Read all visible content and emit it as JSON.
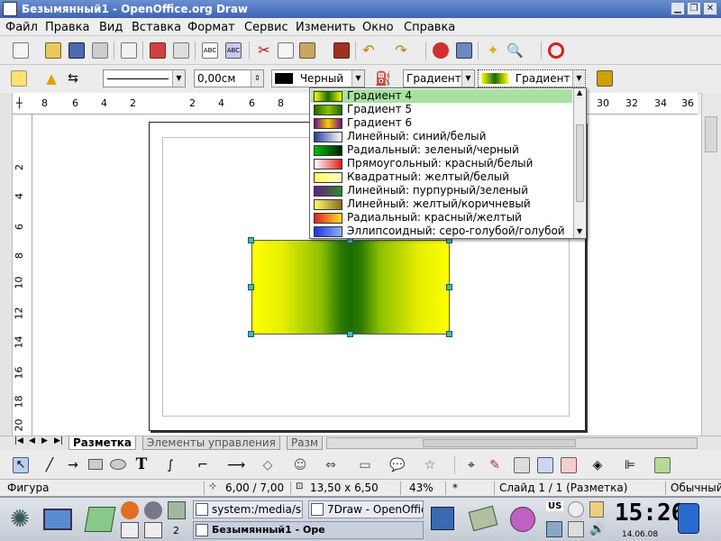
{
  "window": {
    "title": "Безымянный1 - OpenOffice.org Draw"
  },
  "menu": {
    "items": [
      "Файл",
      "Правка",
      "Вид",
      "Вставка",
      "Формат",
      "Сервис",
      "Изменить",
      "Окно",
      "Справка"
    ]
  },
  "line_format": {
    "width": "0,00см",
    "color_label": "Черный",
    "color": "#000000"
  },
  "area": {
    "style": "Градиент",
    "value": "Градиент"
  },
  "gradient_list": {
    "selected": "Градиент 4",
    "items": [
      {
        "label": "Градиент 4",
        "colors": [
          "#ffff00",
          "#1c6a00",
          "#ffff00"
        ]
      },
      {
        "label": "Градиент 5",
        "colors": [
          "#1c6a00",
          "#8dc000",
          "#1c6a00"
        ]
      },
      {
        "label": "Градиент 6",
        "colors": [
          "#6a1080",
          "#ffcc00",
          "#6a1080"
        ]
      },
      {
        "label": "Линейный: синий/белый",
        "colors": [
          "#2a3a9a",
          "#ffffff"
        ]
      },
      {
        "label": "Радиальный: зеленый/черный",
        "colors": [
          "#00c000",
          "#002000"
        ]
      },
      {
        "label": "Прямоугольный: красный/белый",
        "colors": [
          "#ffffff",
          "#e02020"
        ]
      },
      {
        "label": "Квадратный: желтый/белый",
        "colors": [
          "#ffff60",
          "#ffffc0"
        ]
      },
      {
        "label": "Линейный: пурпурный/зеленый",
        "colors": [
          "#6a1a8a",
          "#2a8a2a"
        ]
      },
      {
        "label": "Линейный: желтый/коричневый",
        "colors": [
          "#ffff60",
          "#8a6a20"
        ]
      },
      {
        "label": "Радиальный: красный/желтый",
        "colors": [
          "#e02020",
          "#ffe020"
        ]
      },
      {
        "label": "Эллипсоидный: серо-голубой/голубой",
        "colors": [
          "#2030e0",
          "#8ab0ff"
        ]
      }
    ]
  },
  "ruler": {
    "h_labels": [
      "8",
      "6",
      "4",
      "2",
      "2",
      "4",
      "6",
      "8",
      "30",
      "32",
      "34",
      "36"
    ],
    "v_labels": [
      "2",
      "4",
      "6",
      "8",
      "10",
      "12",
      "14",
      "16",
      "18",
      "20"
    ]
  },
  "tabs": {
    "items": [
      "Разметка",
      "Элементы управления",
      "Разм"
    ]
  },
  "status": {
    "object": "Фигура",
    "position": "6,00 / 7,00",
    "size": "13,50 x 6,50",
    "zoom": "43%",
    "modified": "*",
    "slide": "Слайд 1 / 1 (Разметка)",
    "layout": "Обычный"
  },
  "taskbar": {
    "desktop_number": "2",
    "tasks": [
      {
        "label": "system:/media/sd"
      },
      {
        "label": "7Draw - OpenOffic"
      },
      {
        "label": "Безымянный1 - Ope"
      }
    ],
    "clock": "15:26",
    "date": "14.06.08",
    "keyboard_layout": "US"
  },
  "colors": {
    "title_bar": "#3d64b4",
    "selection": "#a8e1a1",
    "handle": "#3cbcbc"
  }
}
